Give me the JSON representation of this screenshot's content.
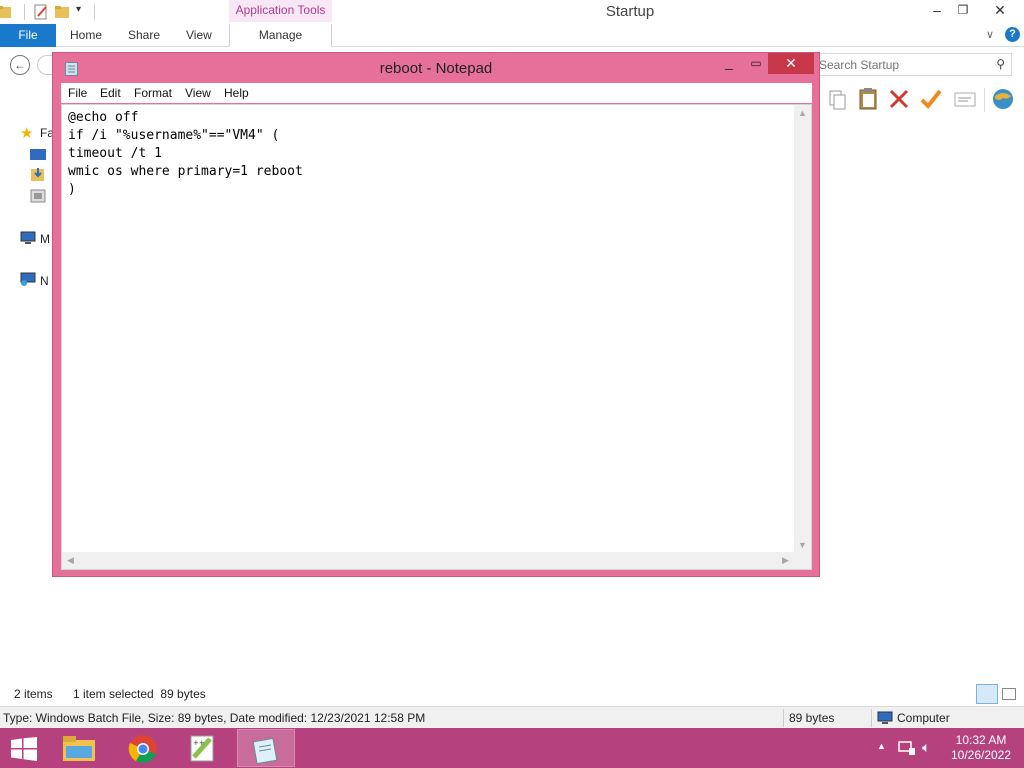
{
  "explorer": {
    "title": "Startup",
    "contextual_tab": "Application Tools",
    "tabs": [
      "File",
      "Home",
      "Share",
      "View",
      "Manage"
    ],
    "search_placeholder": "Search Startup",
    "nav_labels": [
      "Fa",
      "M",
      "N"
    ],
    "status": {
      "items": "2 items",
      "selected": "1 item selected  89 bytes"
    },
    "details": {
      "info": "Type: Windows Batch File, Size: 89 bytes, Date modified: 12/23/2021 12:58 PM",
      "size": "89 bytes",
      "location": "Computer"
    }
  },
  "notepad": {
    "title": "reboot - Notepad",
    "menu": [
      "File",
      "Edit",
      "Format",
      "View",
      "Help"
    ],
    "content": "@echo off\nif /i \"%username%\"==\"VM4\" (\ntimeout /t 1\nwmic os where primary=1 reboot\n)"
  },
  "taskbar": {
    "apps": [
      "start-icon",
      "file-explorer-icon",
      "chrome-icon",
      "notepadplusplus-icon",
      "notepad-icon"
    ],
    "clock": {
      "time": "10:32 AM",
      "date": "10/26/2022"
    }
  },
  "colors": {
    "accent": "#e7709a",
    "taskbar": "#b5427f",
    "file_tab": "#1979ca",
    "close_button": "#c7394a"
  }
}
